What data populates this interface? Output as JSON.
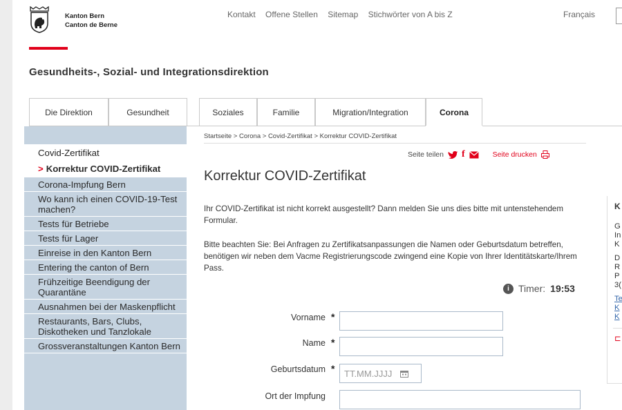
{
  "header": {
    "brand_line1": "Kanton Bern",
    "brand_line2": "Canton de Berne",
    "nav": [
      "Kontakt",
      "Offene Stellen",
      "Sitemap",
      "Stichwörter von A bis Z"
    ],
    "language": "Français"
  },
  "department": "Gesundheits-, Sozial- und Integrationsdirektion",
  "tabs": [
    "Die Direktion",
    "Gesundheit",
    "Soziales",
    "Familie",
    "Migration/Integration",
    "Corona"
  ],
  "sidebar": {
    "section": "Covid-Zertifikat",
    "current_arrow": ">",
    "current": "Korrektur COVID-Zertifikat",
    "items": [
      "Corona-Impfung Bern",
      "Wo kann ich einen COVID-19-Test machen?",
      "Tests für Betriebe",
      "Tests für Lager",
      "Einreise in den Kanton Bern",
      "Entering the canton of Bern",
      "Frühzeitige Beendigung der Quarantäne",
      "Ausnahmen bei der Maskenpflicht",
      "Restaurants, Bars, Clubs, Diskotheken und Tanzlokale",
      "Grossveranstaltungen Kanton Bern"
    ]
  },
  "breadcrumb": "Startseite > Corona > Covid-Zertifikat > Korrektur COVID-Zertifikat",
  "share": {
    "label": "Seite teilen",
    "print": "Seite drucken"
  },
  "title": "Korrektur COVID-Zertifikat",
  "paragraph1": "Ihr COVID-Zertifikat ist nicht korrekt ausgestellt? Dann melden Sie uns dies bitte mit untenstehendem Formular.",
  "paragraph2": "Bitte beachten Sie: Bei Anfragen zu Zertifikatsanpassungen die Namen oder Geburtsdatum betreffen, benötigen wir neben dem Vacme Registrierungscode zwingend eine Kopie von Ihrer Identitätskarte/Ihrem Pass.",
  "timer": {
    "label": "Timer:",
    "value": "19:53"
  },
  "form": {
    "required_mark": "*",
    "firstname_label": "Vorname",
    "lastname_label": "Name",
    "birthdate_label": "Geburtsdatum",
    "birthdate_placeholder": "TT.MM.JJJJ",
    "vaccination_place_label": "Ort der Impfung"
  },
  "right_box": {
    "title": "K",
    "block1": [
      "G",
      "In",
      "K"
    ],
    "block2": [
      "D",
      "R",
      "P",
      "3("
    ],
    "links": [
      "Te",
      "K",
      "K"
    ],
    "icon": "⊏"
  },
  "colors": {
    "accent_red": "#e1001a",
    "sidebar_bg": "#c5d3e0"
  }
}
